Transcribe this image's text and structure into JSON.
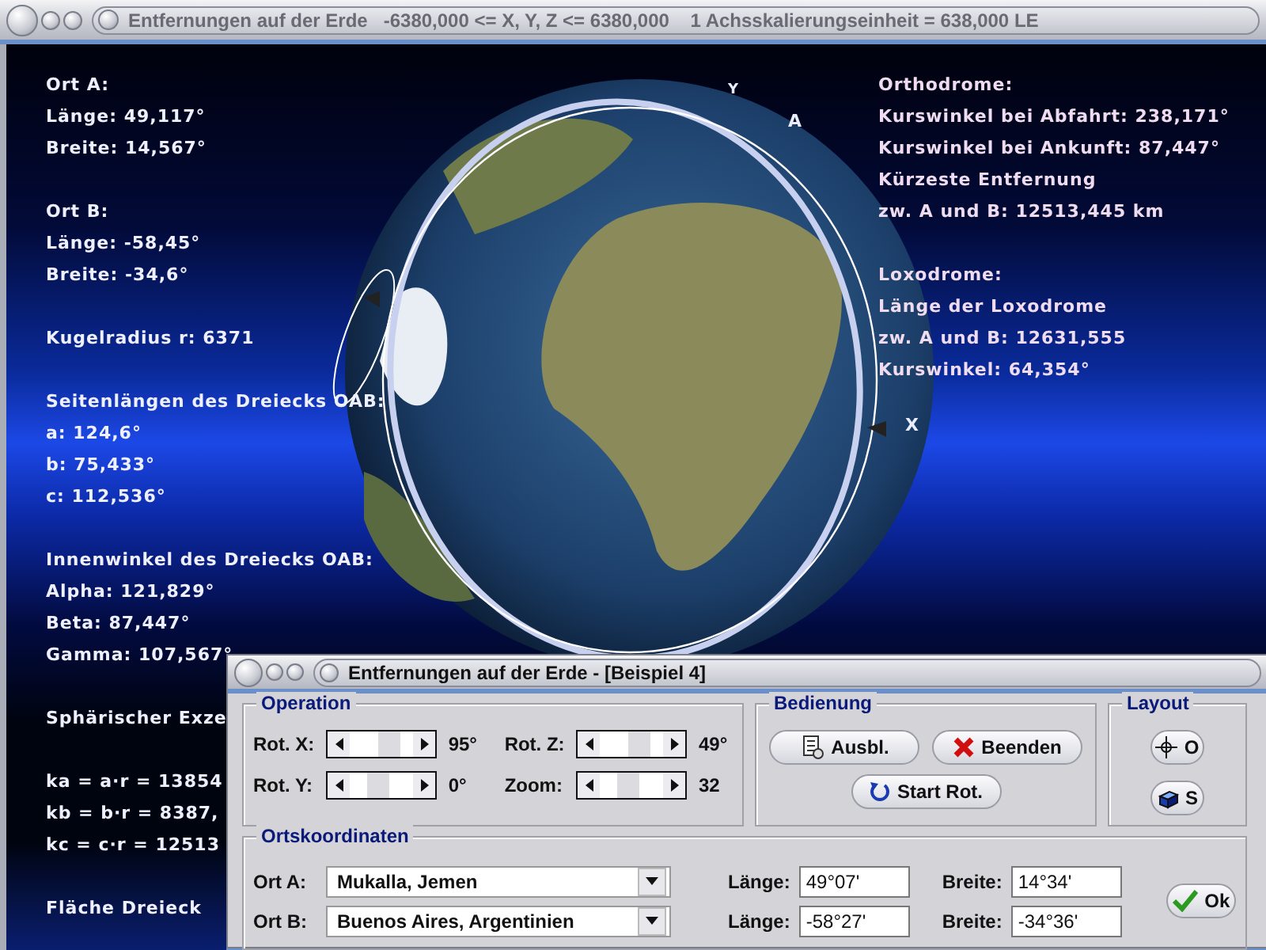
{
  "window": {
    "title": "Entfernungen auf der Erde   -6380,000 <= X, Y, Z <= 6380,000    1 Achsskalierungseinheit = 638,000 LE"
  },
  "left_info": [
    {
      "lines": [
        "Ort A:",
        "Länge: 49,117°",
        "Breite: 14,567°"
      ]
    },
    {
      "lines": [
        "Ort B:",
        "Länge: -58,45°",
        "Breite: -34,6°"
      ]
    },
    {
      "lines": [
        "Kugelradius r: 6371"
      ]
    },
    {
      "lines": [
        "Seitenlängen des Dreiecks OAB:",
        "a: 124,6°",
        "b: 75,433°",
        "c: 112,536°"
      ]
    },
    {
      "lines": [
        "Innenwinkel des Dreiecks OAB:",
        "Alpha: 121,829°",
        "Beta: 87,447°",
        "Gamma: 107,567°"
      ]
    },
    {
      "lines": [
        "Sphärischer Exze"
      ]
    },
    {
      "lines": [
        "ka = a·r = 13854",
        "kb = b·r = 8387,",
        "kc = c·r = 12513"
      ]
    },
    {
      "lines": [
        "Fläche Dreieck"
      ]
    }
  ],
  "right_info": [
    {
      "lines": [
        "Orthodrome:",
        "Kurswinkel bei Abfahrt: 238,171°",
        "Kurswinkel bei Ankunft: 87,447°",
        "Kürzeste Entfernung",
        "zw. A und B: 12513,445 km"
      ]
    },
    {
      "lines": [
        "Loxodrome:",
        "Länge der Loxodrome",
        "zw. A und B: 12631,555",
        "Kurswinkel: 64,354°"
      ]
    }
  ],
  "globe_labels": [
    {
      "kind": "point",
      "text": "A"
    },
    {
      "kind": "axis-x",
      "text": "X"
    },
    {
      "kind": "axis-y",
      "text": "Y"
    }
  ],
  "dialog": {
    "title": "Entfernungen auf der Erde - [Beispiel 4]",
    "operation": {
      "title": "Operation",
      "sliders": [
        {
          "label": "Rot. X:",
          "value": "95°",
          "level": 0.55
        },
        {
          "label": "Rot. Z:",
          "value": "49°",
          "level": 0.55
        },
        {
          "label": "Rot. Y:",
          "value": "0°",
          "level": 0.45
        },
        {
          "label": "Zoom:",
          "value": "32",
          "level": 0.45
        }
      ]
    },
    "bedienung": {
      "title": "Bedienung",
      "buttons": [
        {
          "kind": "hide",
          "label": "Ausbl."
        },
        {
          "kind": "close",
          "label": "Beenden"
        },
        {
          "kind": "rotate",
          "label": "Start Rot."
        }
      ]
    },
    "layout": {
      "title": "Layout",
      "buttons": [
        {
          "kind": "crosshair",
          "label": "O"
        },
        {
          "kind": "cube",
          "label": "S"
        }
      ]
    },
    "ortskoordinaten": {
      "title": "Ortskoordinaten",
      "rows": [
        {
          "label": "Ort A:",
          "place": "Mukalla, Jemen",
          "laenge_label": "Länge:",
          "laenge": "49°07'",
          "breite_label": "Breite:",
          "breite": "14°34'"
        },
        {
          "label": "Ort B:",
          "place": "Buenos Aires, Argentinien",
          "laenge_label": "Länge:",
          "laenge": "-58°27'",
          "breite_label": "Breite:",
          "breite": "-34°36'"
        }
      ]
    },
    "ok_button": "Ok"
  }
}
